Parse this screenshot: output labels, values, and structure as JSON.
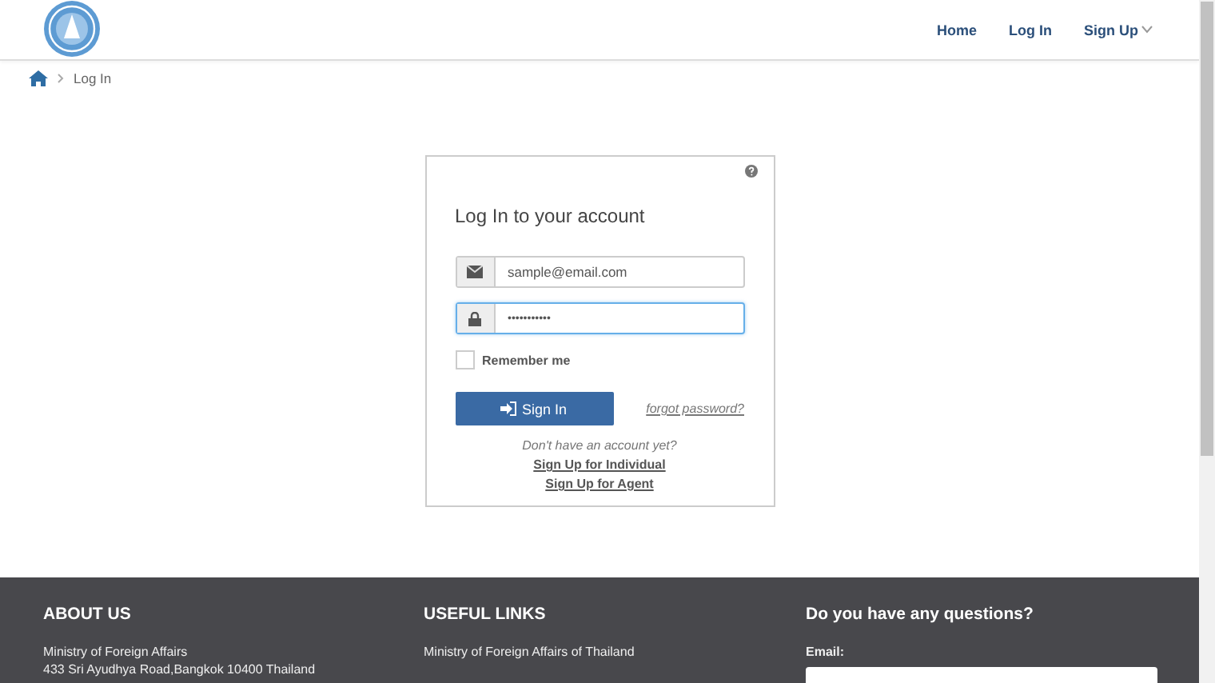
{
  "nav": [
    {
      "label": "Home",
      "dropdown": false
    },
    {
      "label": "Log In",
      "dropdown": false
    },
    {
      "label": "Sign Up",
      "dropdown": true
    }
  ],
  "breadcrumb": {
    "current": "Log In"
  },
  "login": {
    "title": "Log In to your account",
    "email": {
      "value": "sample@email.com",
      "focused": false
    },
    "password": {
      "value": "•••••••••••",
      "focused": true
    },
    "remember": {
      "label": "Remember me",
      "checked": false
    },
    "submit": "Sign In",
    "forgot": "forgot password?",
    "prompt": "Don't have an account yet?",
    "signup_links": [
      "Sign Up for Individual",
      "Sign Up for Agent"
    ]
  },
  "footer": {
    "about": {
      "heading": "ABOUT US",
      "lines": [
        "Ministry of Foreign Affairs",
        "433 Sri Ayudhya Road,Bangkok 10400 Thailand"
      ]
    },
    "links": {
      "heading": "USEFUL LINKS",
      "items": [
        "Ministry of Foreign Affairs of Thailand"
      ]
    },
    "contact": {
      "heading": "Do you have any questions?",
      "email_label": "Email:"
    }
  }
}
